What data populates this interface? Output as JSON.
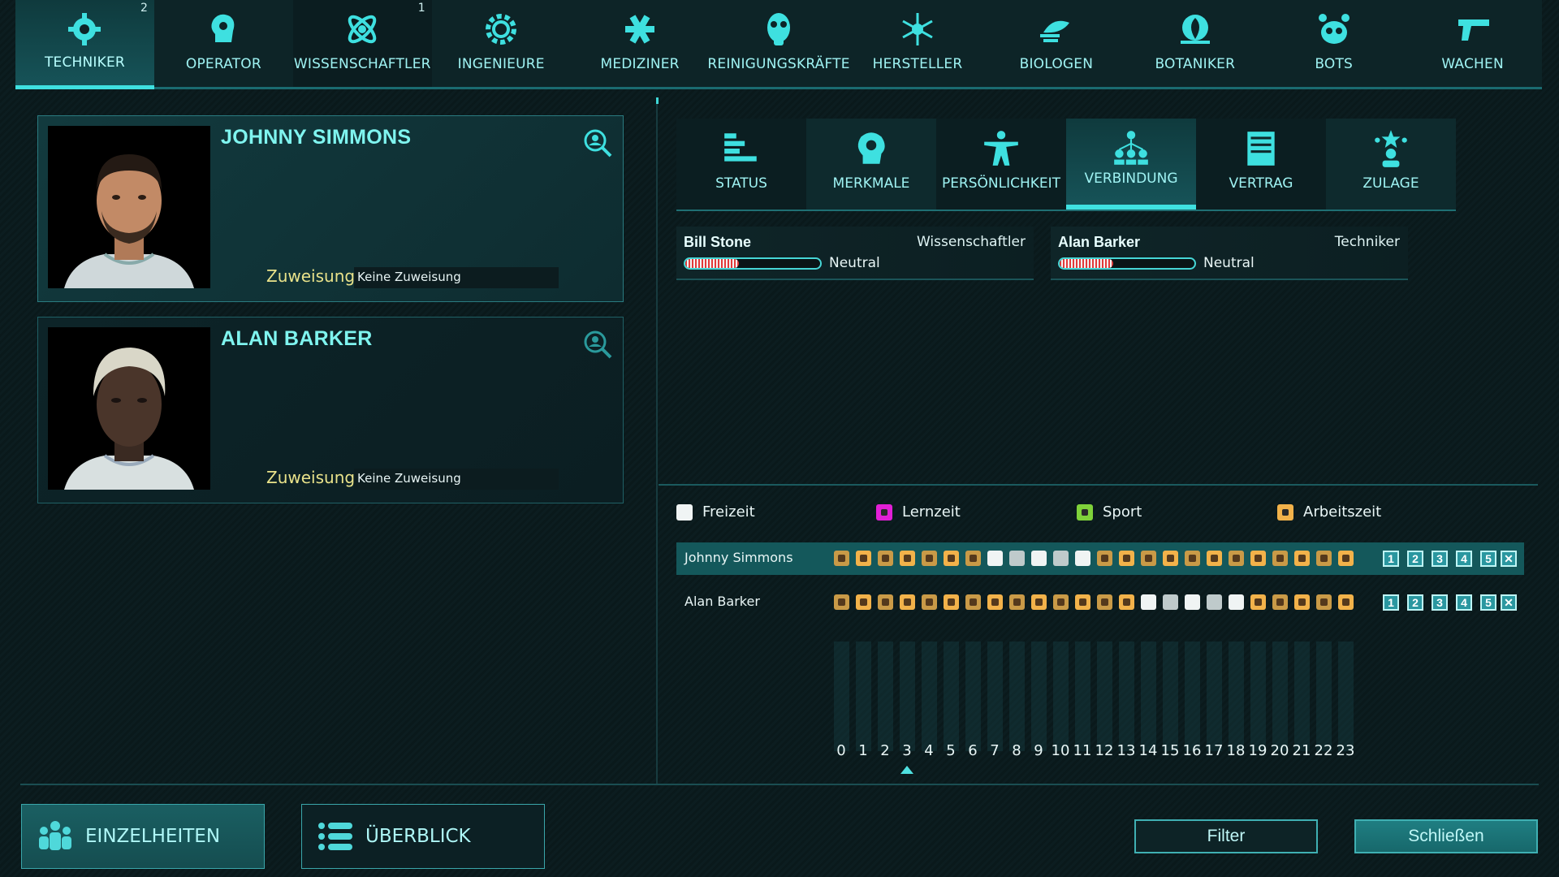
{
  "nav_tabs": [
    {
      "label": "TECHNIKER",
      "badge": "2",
      "icon": "gear-wrench-icon"
    },
    {
      "label": "OPERATOR",
      "badge": "",
      "icon": "head-gear-icon"
    },
    {
      "label": "WISSENSCHAFTLER",
      "badge": "1",
      "icon": "atom-icon"
    },
    {
      "label": "INGENIEURE",
      "badge": "",
      "icon": "cog-icon"
    },
    {
      "label": "MEDIZINER",
      "badge": "",
      "icon": "medical-icon"
    },
    {
      "label": "REINIGUNGSKRÄFTE",
      "badge": "",
      "icon": "gas-mask-icon"
    },
    {
      "label": "HERSTELLER",
      "badge": "",
      "icon": "molecule-icon"
    },
    {
      "label": "BIOLOGEN",
      "badge": "",
      "icon": "dna-icon"
    },
    {
      "label": "BOTANIKER",
      "badge": "",
      "icon": "plant-icon"
    },
    {
      "label": "BOTS",
      "badge": "",
      "icon": "robot-icon"
    },
    {
      "label": "WACHEN",
      "badge": "",
      "icon": "gun-icon"
    }
  ],
  "cards": [
    {
      "name": "JOHNNY SIMMONS",
      "assign_label": "Zuweisung",
      "assign_value": "Keine Zuweisung"
    },
    {
      "name": "ALAN BARKER",
      "assign_label": "Zuweisung",
      "assign_value": "Keine Zuweisung"
    }
  ],
  "detail_tabs": [
    {
      "label": "STATUS",
      "icon": "status-bars-icon"
    },
    {
      "label": "MERKMALE",
      "icon": "head-traits-icon"
    },
    {
      "label": "PERSÖNLICHKEIT",
      "icon": "person-icon"
    },
    {
      "label": "VERBINDUNG",
      "icon": "network-icon"
    },
    {
      "label": "VERTRAG",
      "icon": "contract-icon"
    },
    {
      "label": "ZULAGE",
      "icon": "award-icon"
    }
  ],
  "connections": [
    {
      "name": "Bill Stone",
      "role": "Wissenschaftler",
      "state": "Neutral",
      "level": 0.4
    },
    {
      "name": "Alan Barker",
      "role": "Techniker",
      "state": "Neutral",
      "level": 0.4
    }
  ],
  "legend": [
    {
      "label": "Freizeit",
      "color": "#f0f4f4"
    },
    {
      "label": "Lernzeit",
      "color": "#e21fd6"
    },
    {
      "label": "Sport",
      "color": "#7fd23a"
    },
    {
      "label": "Arbeitszeit",
      "color": "#f2b24a"
    }
  ],
  "schedule": [
    {
      "name": "Johnny Simmons",
      "slots": [
        "work",
        "work",
        "work",
        "work",
        "work",
        "work",
        "work",
        "free",
        "free-dim",
        "free",
        "free-dim",
        "free",
        "work",
        "work",
        "work",
        "work",
        "work",
        "work",
        "work",
        "work",
        "work",
        "work",
        "work",
        "work"
      ]
    },
    {
      "name": "Alan Barker",
      "slots": [
        "work",
        "work",
        "work",
        "work",
        "work",
        "work",
        "work",
        "work",
        "work",
        "work",
        "work",
        "work",
        "work",
        "work",
        "free",
        "free-dim",
        "free",
        "free-dim",
        "free",
        "work",
        "work",
        "work",
        "work",
        "work"
      ]
    }
  ],
  "preset_buttons": [
    "1",
    "2",
    "3",
    "4",
    "5",
    "✕"
  ],
  "hours": [
    "0",
    "1",
    "2",
    "3",
    "4",
    "5",
    "6",
    "7",
    "8",
    "9",
    "10",
    "11",
    "12",
    "13",
    "14",
    "15",
    "16",
    "17",
    "18",
    "19",
    "20",
    "21",
    "22",
    "23"
  ],
  "current_hour": 3,
  "bottom": {
    "details_label": "EINZELHEITEN",
    "overview_label": "ÜBERBLICK",
    "filter_label": "Filter",
    "close_label": "Schließen"
  }
}
